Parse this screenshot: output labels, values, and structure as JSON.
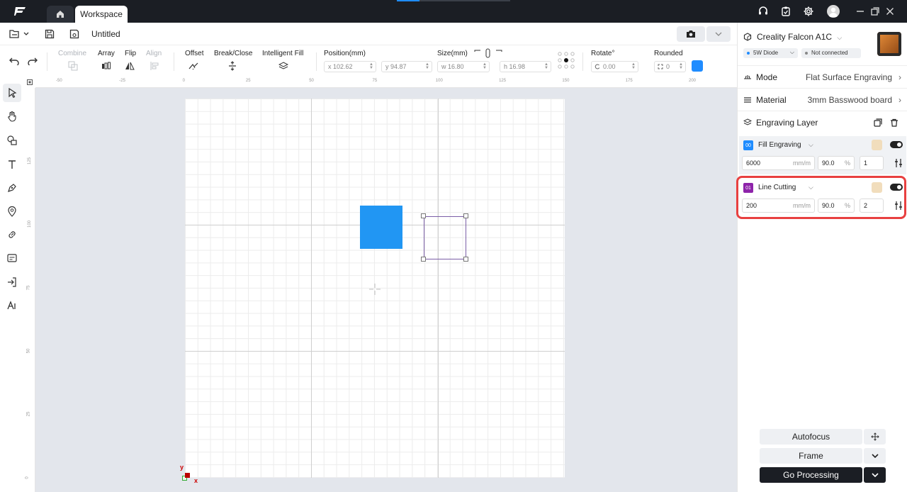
{
  "titlebar": {
    "tabs": [
      {
        "label": ""
      },
      {
        "label": "Workspace"
      }
    ],
    "icons": [
      "headset-icon",
      "clipboard-icon",
      "gear-icon",
      "avatar",
      "minimize-icon",
      "restore-icon",
      "close-icon"
    ]
  },
  "file": {
    "title": "Untitled"
  },
  "toolbar": {
    "combine": "Combine",
    "array": "Array",
    "flip": "Flip",
    "align": "Align",
    "offset": "Offset",
    "break_close": "Break/Close",
    "intelligent_fill": "Intelligent Fill",
    "position_label": "Position(mm)",
    "x": "x 102.62",
    "y": "y 94.87",
    "size_label": "Size(mm)",
    "w": "w 16.80",
    "h": "h 16.98",
    "rotate_label": "Rotate°",
    "rotate": "0.00",
    "rounded_label": "Rounded",
    "rounded": "0",
    "fill_color": "#1f8cff"
  },
  "rulers": {
    "top": [
      "-50",
      "-25",
      "0",
      "25",
      "50",
      "75",
      "100",
      "125",
      "150",
      "175",
      "200"
    ],
    "left": [
      "125",
      "100",
      "75",
      "50",
      "25",
      "0"
    ]
  },
  "canvas": {
    "origin_y": "y",
    "origin_x": "x",
    "shape_color": "#2196f3",
    "selection_color": "#7b5ea7"
  },
  "device": {
    "name": "Creality Falcon A1C",
    "laser": "5W Diode",
    "status": "Not connected"
  },
  "settings": {
    "mode_label": "Mode",
    "mode_value": "Flat Surface Engraving",
    "material_label": "Material",
    "material_value": "3mm Basswood board",
    "layer_header": "Engraving Layer"
  },
  "layers": [
    {
      "index": "00",
      "name": "Fill Engraving",
      "speed": "6000",
      "speed_unit": "mm/m",
      "power": "90.0",
      "power_unit": "%",
      "passes": "1",
      "badge_color": "#1f8cff"
    },
    {
      "index": "01",
      "name": "Line Cutting",
      "speed": "200",
      "speed_unit": "mm/m",
      "power": "90.0",
      "power_unit": "%",
      "passes": "2",
      "badge_color": "#8e24aa"
    }
  ],
  "actions": {
    "autofocus": "Autofocus",
    "frame": "Frame",
    "go": "Go Processing"
  }
}
